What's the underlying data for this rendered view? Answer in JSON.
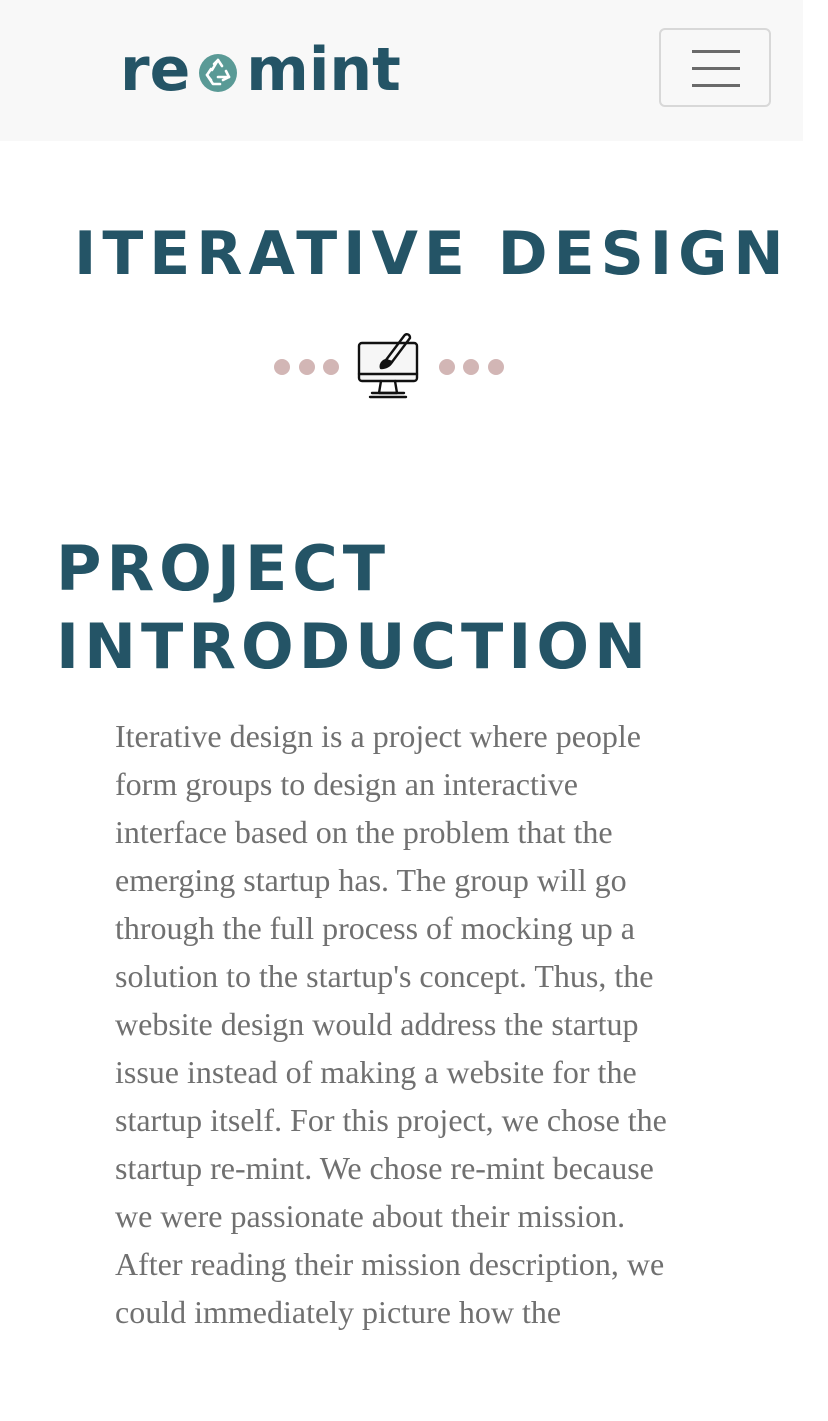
{
  "navbar": {
    "logo_left": "re",
    "logo_right": "mint",
    "logo_icon": "recycle-icon",
    "menu_icon": "hamburger-menu-icon"
  },
  "page": {
    "title": "ITERATIVE DESIGN",
    "divider_icon": "computer-design-icon"
  },
  "section": {
    "heading_line1": "PROJECT",
    "heading_line2": "INTRODUCTION",
    "body": "Iterative design is a project where people form groups to design an interactive interface based on the problem that the emerging startup has. The group will go through the full process of mocking up a solution to the startup's concept. Thus, the website design would address the startup issue instead of making a website for the startup itself. For this project, we chose the startup re-mint. We chose re-mint because we were passionate about their mission. After reading their mission description, we could immediately picture how the"
  },
  "colors": {
    "brand": "#245466",
    "logo_icon": "#5a9a96",
    "divider_dots": "#d2b6b5",
    "body_text": "#707070",
    "navbar_bg": "#f8f8f8"
  }
}
